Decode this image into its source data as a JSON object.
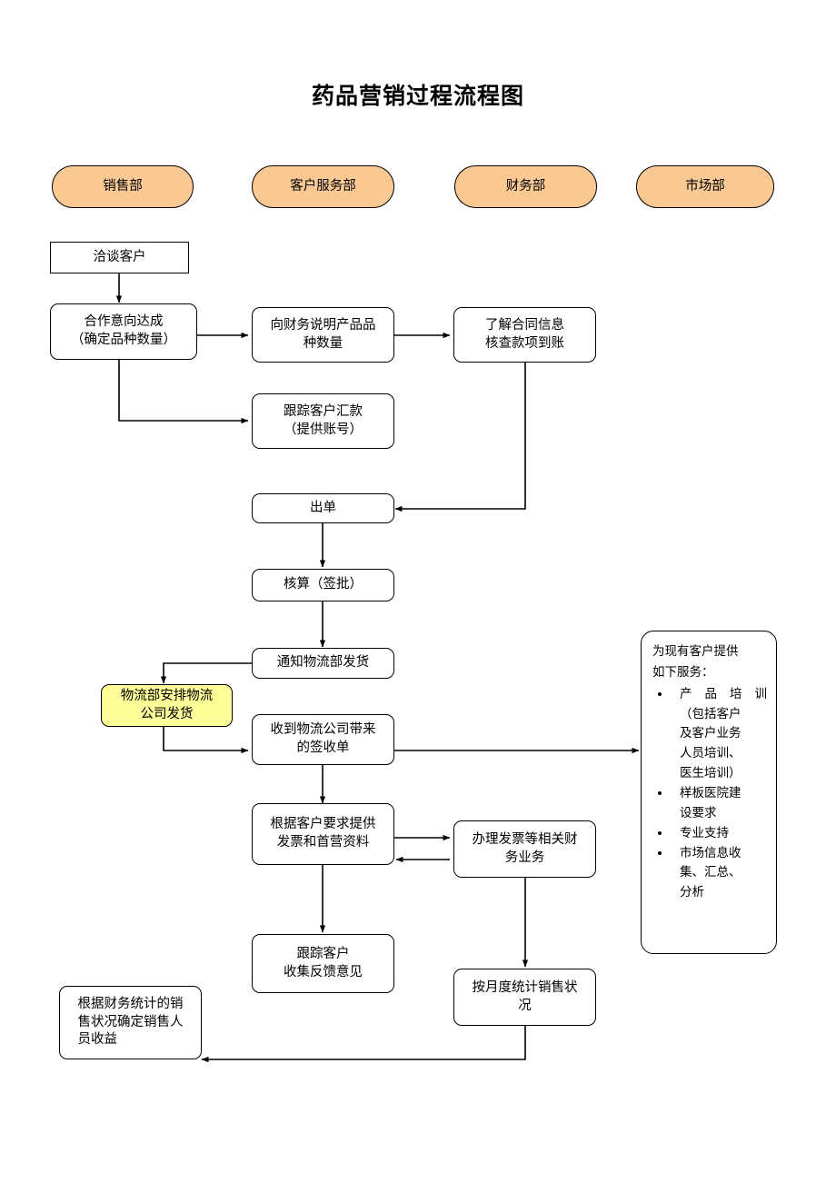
{
  "title": "药品营销过程流程图",
  "colors": {
    "department_fill": "#f9c893",
    "highlight_fill": "#ffff99",
    "node_fill": "#ffffff",
    "stroke": "#000000"
  },
  "departments": [
    {
      "id": "dept-sales",
      "label": "销售部"
    },
    {
      "id": "dept-customer-service",
      "label": "客户服务部"
    },
    {
      "id": "dept-finance",
      "label": "财务部"
    },
    {
      "id": "dept-marketing",
      "label": "市场部"
    }
  ],
  "nodes": [
    {
      "id": "n1",
      "label": "洽谈客户",
      "column": "销售部",
      "shape": "rectangle",
      "fill": "#ffffff"
    },
    {
      "id": "n2",
      "label": "合作意向达成\n（确定品种数量）",
      "column": "销售部",
      "shape": "rounded-rectangle",
      "fill": "#ffffff"
    },
    {
      "id": "n3",
      "label": "向财务说明产品品\n种数量",
      "column": "客户服务部",
      "shape": "rounded-rectangle",
      "fill": "#ffffff"
    },
    {
      "id": "n4",
      "label": "了解合同信息\n核查款项到账",
      "column": "财务部",
      "shape": "rounded-rectangle",
      "fill": "#ffffff"
    },
    {
      "id": "n5",
      "label": "跟踪客户汇款\n（提供账号）",
      "column": "客户服务部",
      "shape": "rounded-rectangle",
      "fill": "#ffffff"
    },
    {
      "id": "n6",
      "label": "出单",
      "column": "客户服务部",
      "shape": "rounded-rectangle",
      "fill": "#ffffff"
    },
    {
      "id": "n7",
      "label": "核算（签批）",
      "column": "客户服务部",
      "shape": "rounded-rectangle",
      "fill": "#ffffff"
    },
    {
      "id": "n8",
      "label": "通知物流部发货",
      "column": "客户服务部",
      "shape": "rounded-rectangle",
      "fill": "#ffffff"
    },
    {
      "id": "n9",
      "label": "物流部安排物流\n公司发货",
      "column": "销售部",
      "shape": "rounded-rectangle",
      "fill": "#ffff99"
    },
    {
      "id": "n10",
      "label": "收到物流公司带来\n的签收单",
      "column": "客户服务部",
      "shape": "rounded-rectangle",
      "fill": "#ffffff"
    },
    {
      "id": "n11",
      "label": "根据客户要求提供\n发票和首营资料",
      "column": "客户服务部",
      "shape": "rounded-rectangle",
      "fill": "#ffffff"
    },
    {
      "id": "n12",
      "label": "办理发票等相关财\n务业务",
      "column": "财务部",
      "shape": "rounded-rectangle",
      "fill": "#ffffff"
    },
    {
      "id": "n13",
      "label": "跟踪客户\n收集反馈意见",
      "column": "客户服务部",
      "shape": "rounded-rectangle",
      "fill": "#ffffff"
    },
    {
      "id": "n14",
      "label": "按月度统计销售状\n况",
      "column": "财务部",
      "shape": "rounded-rectangle",
      "fill": "#ffffff"
    },
    {
      "id": "n15",
      "label": "根据财务统计的销\n售状况确定销售人\n员收益",
      "column": "销售部",
      "shape": "rounded-rectangle",
      "fill": "#ffffff"
    }
  ],
  "services_box": {
    "id": "n16",
    "column": "市场部",
    "header_line1": "为现有客户提供",
    "header_line2": "如下服务：",
    "items": [
      "产品培训（包括客户及客户业务人员培训、医生培训）",
      "样板医院建设要求",
      "专业支持",
      "市场信息收集、汇总、分析"
    ],
    "item_lines": [
      [
        "产 品 培 训",
        "（包括客户",
        "及客户业务",
        "人员培训、",
        "医生培训）"
      ],
      [
        "样板医院建",
        "设要求"
      ],
      [
        "专业支持"
      ],
      [
        "市场信息收",
        "集、汇总、",
        "分析"
      ]
    ]
  },
  "edges": [
    {
      "from": "洽谈客户",
      "to": "合作意向达成（确定品种数量）"
    },
    {
      "from": "合作意向达成（确定品种数量）",
      "to": "向财务说明产品品种数量"
    },
    {
      "from": "合作意向达成（确定品种数量）",
      "to": "跟踪客户汇款（提供账号）"
    },
    {
      "from": "向财务说明产品品种数量",
      "to": "了解合同信息核查款项到账"
    },
    {
      "from": "了解合同信息核查款项到账",
      "to": "出单"
    },
    {
      "from": "出单",
      "to": "核算（签批）"
    },
    {
      "from": "核算（签批）",
      "to": "通知物流部发货"
    },
    {
      "from": "通知物流部发货",
      "to": "物流部安排物流公司发货"
    },
    {
      "from": "物流部安排物流公司发货",
      "to": "收到物流公司带来的签收单"
    },
    {
      "from": "收到物流公司带来的签收单",
      "to": "为现有客户提供如下服务"
    },
    {
      "from": "收到物流公司带来的签收单",
      "to": "根据客户要求提供发票和首营资料"
    },
    {
      "from": "根据客户要求提供发票和首营资料",
      "to": "办理发票等相关财务业务"
    },
    {
      "from": "办理发票等相关财务业务",
      "to": "根据客户要求提供发票和首营资料"
    },
    {
      "from": "根据客户要求提供发票和首营资料",
      "to": "跟踪客户收集反馈意见"
    },
    {
      "from": "办理发票等相关财务业务",
      "to": "按月度统计销售状况"
    },
    {
      "from": "按月度统计销售状况",
      "to": "根据财务统计的销售状况确定销售人员收益"
    }
  ]
}
